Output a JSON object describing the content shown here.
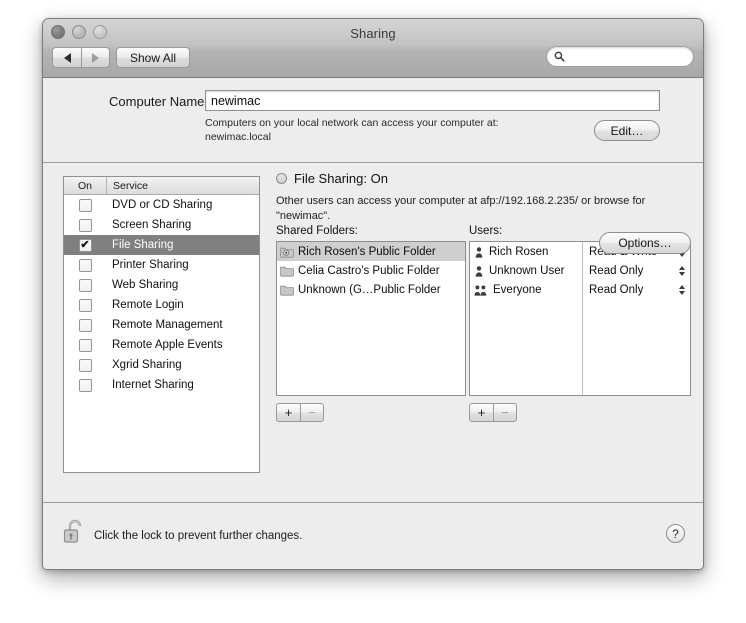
{
  "window": {
    "title": "Sharing",
    "traffic_lights": [
      "close",
      "minimize",
      "zoom"
    ]
  },
  "toolbar": {
    "back_icon": "triangle-left-icon",
    "forward_icon": "triangle-right-icon",
    "show_all_label": "Show All",
    "search": {
      "value": "",
      "placeholder": "",
      "icon": "search-icon"
    }
  },
  "computer_name": {
    "label": "Computer Name:",
    "value": "newimac",
    "hint_line1": "Computers on your local network can access your computer at:",
    "hint_line2": "newimac.local",
    "edit_label": "Edit…"
  },
  "services": {
    "columns": {
      "on": "On",
      "service": "Service"
    },
    "rows": [
      {
        "name": "DVD or CD Sharing",
        "checked": false,
        "selected": false
      },
      {
        "name": "Screen Sharing",
        "checked": false,
        "selected": false
      },
      {
        "name": "File Sharing",
        "checked": true,
        "selected": true
      },
      {
        "name": "Printer Sharing",
        "checked": false,
        "selected": false
      },
      {
        "name": "Web Sharing",
        "checked": false,
        "selected": false
      },
      {
        "name": "Remote Login",
        "checked": false,
        "selected": false
      },
      {
        "name": "Remote Management",
        "checked": false,
        "selected": false
      },
      {
        "name": "Remote Apple Events",
        "checked": false,
        "selected": false
      },
      {
        "name": "Xgrid Sharing",
        "checked": false,
        "selected": false
      },
      {
        "name": "Internet Sharing",
        "checked": false,
        "selected": false
      }
    ]
  },
  "detail": {
    "status_title": "File Sharing: On",
    "status_indicator": "status-circle-icon",
    "description": "Other users can access your computer at afp://192.168.2.235/ or browse for \"newimac\".",
    "shared_folders": {
      "label": "Shared Folders:",
      "items": [
        {
          "name": "Rich Rosen's Public Folder",
          "icon": "drop-box-folder-icon",
          "selected": true
        },
        {
          "name": "Celia Castro's Public Folder",
          "icon": "folder-icon",
          "selected": false
        },
        {
          "name": "Unknown (G…Public Folder",
          "icon": "folder-icon",
          "selected": false
        }
      ],
      "add_label": "+",
      "remove_label": "−"
    },
    "users": {
      "label": "Users:",
      "items": [
        {
          "name": "Rich Rosen",
          "icon": "user-icon",
          "permission": "Read & Write"
        },
        {
          "name": "Unknown User",
          "icon": "user-icon",
          "permission": "Read Only"
        },
        {
          "name": "Everyone",
          "icon": "group-icon",
          "permission": "Read Only"
        }
      ],
      "add_label": "+",
      "remove_label": "−"
    },
    "options_label": "Options…"
  },
  "footer": {
    "lock_icon": "unlocked-padlock-icon",
    "lock_text": "Click the lock to prevent further changes.",
    "help_label": "?"
  }
}
